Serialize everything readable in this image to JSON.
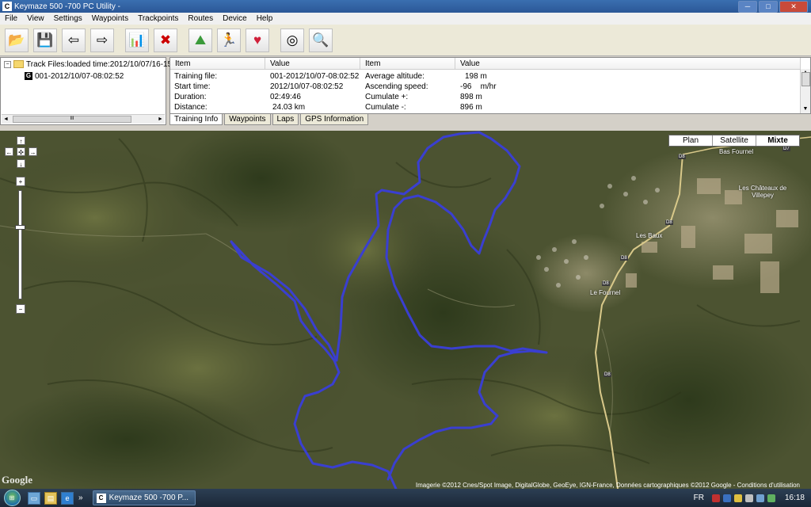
{
  "window": {
    "title": "Keymaze 500 -700 PC Utility -",
    "app_icon": "C",
    "controls": {
      "minimize": "─",
      "maximize": "□",
      "close": "✕"
    }
  },
  "menu": [
    "File",
    "View",
    "Settings",
    "Waypoints",
    "Trackpoints",
    "Routes",
    "Device",
    "Help"
  ],
  "toolbar": {
    "buttons": [
      {
        "name": "open-folder-icon",
        "glyph": "📂"
      },
      {
        "name": "save-icon",
        "glyph": "💾"
      },
      {
        "name": "import-icon",
        "glyph": "⇦"
      },
      {
        "name": "export-icon",
        "glyph": "⇨"
      },
      {
        "name": "chart-icon",
        "glyph": "📊"
      },
      {
        "name": "delete-icon",
        "glyph": "✖"
      },
      {
        "name": "altitude-profile-icon",
        "glyph": "⛰"
      },
      {
        "name": "runner-icon",
        "glyph": "🏃"
      },
      {
        "name": "heart-rate-icon",
        "glyph": "♥"
      },
      {
        "name": "disc-icon",
        "glyph": "◎"
      },
      {
        "name": "magnifier-disc-icon",
        "glyph": "🔍"
      }
    ]
  },
  "tree": {
    "root_label": "Track Files:loaded time:2012/10/07/16-15",
    "expander": "−",
    "track_icon": "G",
    "track_label": "001-2012/10/07-08:02:52",
    "scroll": {
      "left": "◄",
      "right": "►",
      "thumb": "III"
    }
  },
  "info_table": {
    "headers": [
      "Item",
      "Value",
      "Item",
      "Value"
    ],
    "rows": [
      [
        "Training file:",
        "001-2012/10/07-08:02:52",
        "Average altitude:",
        "198 m"
      ],
      [
        "Start time:",
        "2012/10/07-08:02:52",
        "Ascending speed:",
        "-96    m/hr"
      ],
      [
        "Duration:",
        "02:49:46",
        "Cumulate +:",
        "898 m"
      ],
      [
        "Distance:",
        "24.03 km",
        "Cumulate -:",
        "896 m"
      ]
    ],
    "scroll": {
      "up": "▲",
      "down": "▼"
    }
  },
  "tabs": [
    "Training Info",
    "Waypoints",
    "Laps",
    "GPS Information"
  ],
  "active_tab": 0,
  "map": {
    "types": [
      "Plan",
      "Satellite",
      "Mixte"
    ],
    "active_type": 2,
    "pan": {
      "up": "↑",
      "left": "←",
      "center": "✣",
      "right": "→",
      "down": "↓"
    },
    "zoom": {
      "in": "+",
      "out": "−",
      "level_fraction": 0.33
    },
    "google_logo": "Google",
    "attribution": "Imagerie ©2012 Cnes/Spot Image, DigitalGlobe, GeoEye, IGN-France, Données cartographiques ©2012 Google - Conditions d'utilisation",
    "places": [
      "Les Châteaux de Villepey",
      "Les Baux",
      "Le Fournel",
      "Bas Fournel"
    ],
    "roads": [
      "D8",
      "D8",
      "D8",
      "D8",
      "D8",
      "D7"
    ],
    "track_color": "#3a3fd0"
  },
  "taskbar": {
    "start": "⊞",
    "quicklaunch": [
      "desktop-icon",
      "folder-icon",
      "ie-icon"
    ],
    "quicklaunch_glyphs": [
      "▭",
      "▤",
      "e"
    ],
    "overflow": "»",
    "task_icon": "C",
    "task_label": "Keymaze 500 -700 P...",
    "lang": "FR",
    "clock": "16:18"
  }
}
